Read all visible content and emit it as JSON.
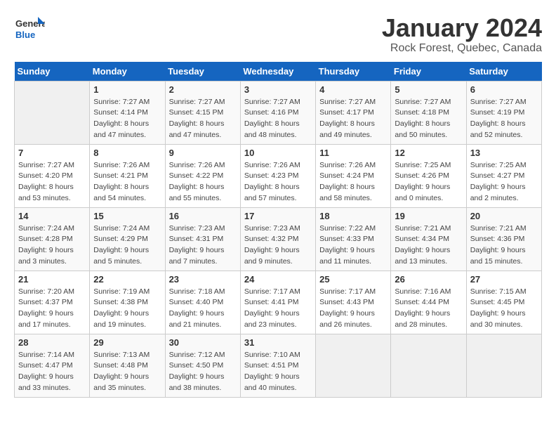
{
  "header": {
    "logo_line1": "General",
    "logo_line2": "Blue",
    "title": "January 2024",
    "subtitle": "Rock Forest, Quebec, Canada"
  },
  "days_of_week": [
    "Sunday",
    "Monday",
    "Tuesday",
    "Wednesday",
    "Thursday",
    "Friday",
    "Saturday"
  ],
  "weeks": [
    [
      {
        "day": "",
        "empty": true
      },
      {
        "day": "1",
        "sunrise": "Sunrise: 7:27 AM",
        "sunset": "Sunset: 4:14 PM",
        "daylight": "Daylight: 8 hours and 47 minutes."
      },
      {
        "day": "2",
        "sunrise": "Sunrise: 7:27 AM",
        "sunset": "Sunset: 4:15 PM",
        "daylight": "Daylight: 8 hours and 47 minutes."
      },
      {
        "day": "3",
        "sunrise": "Sunrise: 7:27 AM",
        "sunset": "Sunset: 4:16 PM",
        "daylight": "Daylight: 8 hours and 48 minutes."
      },
      {
        "day": "4",
        "sunrise": "Sunrise: 7:27 AM",
        "sunset": "Sunset: 4:17 PM",
        "daylight": "Daylight: 8 hours and 49 minutes."
      },
      {
        "day": "5",
        "sunrise": "Sunrise: 7:27 AM",
        "sunset": "Sunset: 4:18 PM",
        "daylight": "Daylight: 8 hours and 50 minutes."
      },
      {
        "day": "6",
        "sunrise": "Sunrise: 7:27 AM",
        "sunset": "Sunset: 4:19 PM",
        "daylight": "Daylight: 8 hours and 52 minutes."
      }
    ],
    [
      {
        "day": "7",
        "sunrise": "Sunrise: 7:27 AM",
        "sunset": "Sunset: 4:20 PM",
        "daylight": "Daylight: 8 hours and 53 minutes."
      },
      {
        "day": "8",
        "sunrise": "Sunrise: 7:26 AM",
        "sunset": "Sunset: 4:21 PM",
        "daylight": "Daylight: 8 hours and 54 minutes."
      },
      {
        "day": "9",
        "sunrise": "Sunrise: 7:26 AM",
        "sunset": "Sunset: 4:22 PM",
        "daylight": "Daylight: 8 hours and 55 minutes."
      },
      {
        "day": "10",
        "sunrise": "Sunrise: 7:26 AM",
        "sunset": "Sunset: 4:23 PM",
        "daylight": "Daylight: 8 hours and 57 minutes."
      },
      {
        "day": "11",
        "sunrise": "Sunrise: 7:26 AM",
        "sunset": "Sunset: 4:24 PM",
        "daylight": "Daylight: 8 hours and 58 minutes."
      },
      {
        "day": "12",
        "sunrise": "Sunrise: 7:25 AM",
        "sunset": "Sunset: 4:26 PM",
        "daylight": "Daylight: 9 hours and 0 minutes."
      },
      {
        "day": "13",
        "sunrise": "Sunrise: 7:25 AM",
        "sunset": "Sunset: 4:27 PM",
        "daylight": "Daylight: 9 hours and 2 minutes."
      }
    ],
    [
      {
        "day": "14",
        "sunrise": "Sunrise: 7:24 AM",
        "sunset": "Sunset: 4:28 PM",
        "daylight": "Daylight: 9 hours and 3 minutes."
      },
      {
        "day": "15",
        "sunrise": "Sunrise: 7:24 AM",
        "sunset": "Sunset: 4:29 PM",
        "daylight": "Daylight: 9 hours and 5 minutes."
      },
      {
        "day": "16",
        "sunrise": "Sunrise: 7:23 AM",
        "sunset": "Sunset: 4:31 PM",
        "daylight": "Daylight: 9 hours and 7 minutes."
      },
      {
        "day": "17",
        "sunrise": "Sunrise: 7:23 AM",
        "sunset": "Sunset: 4:32 PM",
        "daylight": "Daylight: 9 hours and 9 minutes."
      },
      {
        "day": "18",
        "sunrise": "Sunrise: 7:22 AM",
        "sunset": "Sunset: 4:33 PM",
        "daylight": "Daylight: 9 hours and 11 minutes."
      },
      {
        "day": "19",
        "sunrise": "Sunrise: 7:21 AM",
        "sunset": "Sunset: 4:34 PM",
        "daylight": "Daylight: 9 hours and 13 minutes."
      },
      {
        "day": "20",
        "sunrise": "Sunrise: 7:21 AM",
        "sunset": "Sunset: 4:36 PM",
        "daylight": "Daylight: 9 hours and 15 minutes."
      }
    ],
    [
      {
        "day": "21",
        "sunrise": "Sunrise: 7:20 AM",
        "sunset": "Sunset: 4:37 PM",
        "daylight": "Daylight: 9 hours and 17 minutes."
      },
      {
        "day": "22",
        "sunrise": "Sunrise: 7:19 AM",
        "sunset": "Sunset: 4:38 PM",
        "daylight": "Daylight: 9 hours and 19 minutes."
      },
      {
        "day": "23",
        "sunrise": "Sunrise: 7:18 AM",
        "sunset": "Sunset: 4:40 PM",
        "daylight": "Daylight: 9 hours and 21 minutes."
      },
      {
        "day": "24",
        "sunrise": "Sunrise: 7:17 AM",
        "sunset": "Sunset: 4:41 PM",
        "daylight": "Daylight: 9 hours and 23 minutes."
      },
      {
        "day": "25",
        "sunrise": "Sunrise: 7:17 AM",
        "sunset": "Sunset: 4:43 PM",
        "daylight": "Daylight: 9 hours and 26 minutes."
      },
      {
        "day": "26",
        "sunrise": "Sunrise: 7:16 AM",
        "sunset": "Sunset: 4:44 PM",
        "daylight": "Daylight: 9 hours and 28 minutes."
      },
      {
        "day": "27",
        "sunrise": "Sunrise: 7:15 AM",
        "sunset": "Sunset: 4:45 PM",
        "daylight": "Daylight: 9 hours and 30 minutes."
      }
    ],
    [
      {
        "day": "28",
        "sunrise": "Sunrise: 7:14 AM",
        "sunset": "Sunset: 4:47 PM",
        "daylight": "Daylight: 9 hours and 33 minutes."
      },
      {
        "day": "29",
        "sunrise": "Sunrise: 7:13 AM",
        "sunset": "Sunset: 4:48 PM",
        "daylight": "Daylight: 9 hours and 35 minutes."
      },
      {
        "day": "30",
        "sunrise": "Sunrise: 7:12 AM",
        "sunset": "Sunset: 4:50 PM",
        "daylight": "Daylight: 9 hours and 38 minutes."
      },
      {
        "day": "31",
        "sunrise": "Sunrise: 7:10 AM",
        "sunset": "Sunset: 4:51 PM",
        "daylight": "Daylight: 9 hours and 40 minutes."
      },
      {
        "day": "",
        "empty": true
      },
      {
        "day": "",
        "empty": true
      },
      {
        "day": "",
        "empty": true
      }
    ]
  ]
}
